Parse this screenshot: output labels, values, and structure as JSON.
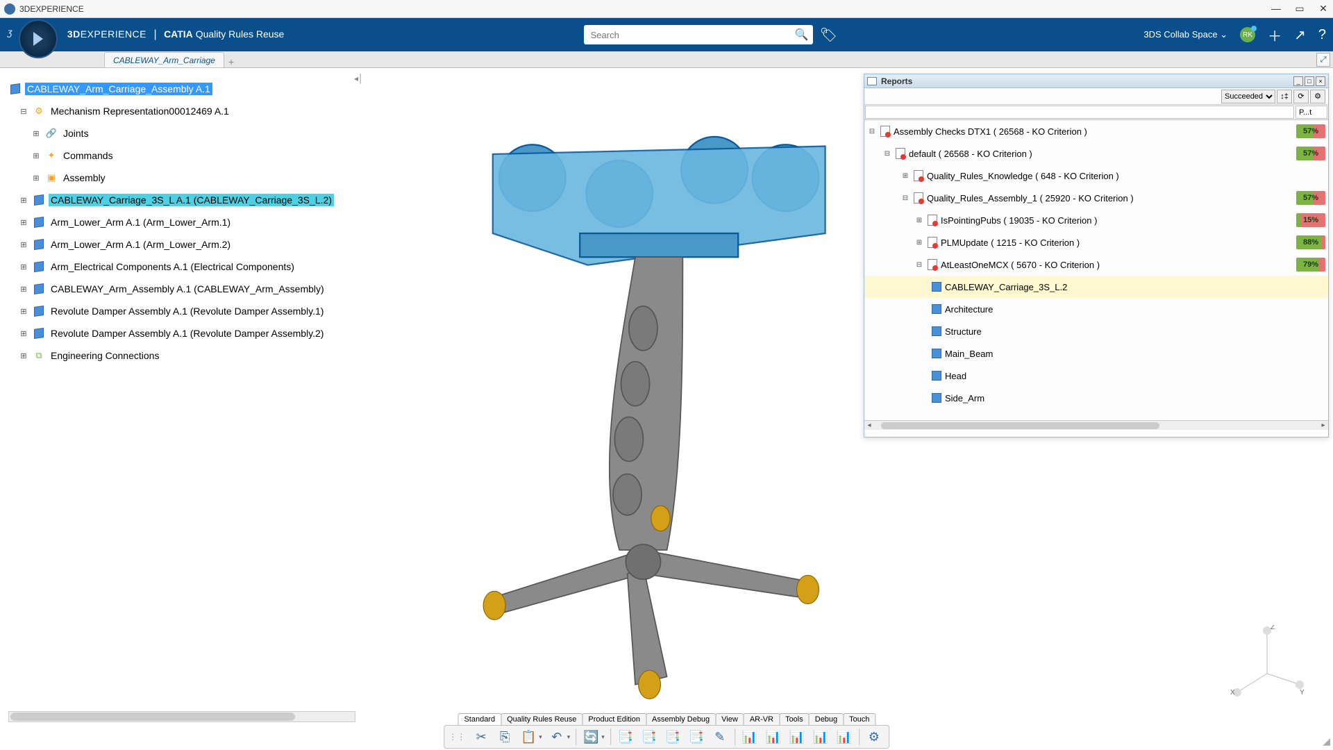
{
  "window": {
    "title": "3DEXPERIENCE"
  },
  "header": {
    "brand_prefix": "3D",
    "brand_suffix": "EXPERIENCE",
    "separator": "|",
    "catia": "CATIA",
    "module": "Quality Rules Reuse",
    "search_placeholder": "Search",
    "collab": "3DS Collab Space",
    "avatar": "RK"
  },
  "tabbar": {
    "tab0": "CABLEWAY_Arm_Carriage"
  },
  "tree": {
    "root": "CABLEWAY_Arm_Carriage_Assembly A.1",
    "n1": "Mechanism Representation00012469 A.1",
    "n1a": "Joints",
    "n1b": "Commands",
    "n1c": "Assembly",
    "n2": "CABLEWAY_Carriage_3S_L A.1 (CABLEWAY_Carriage_3S_L.2)",
    "n3": "Arm_Lower_Arm A.1 (Arm_Lower_Arm.1)",
    "n4": "Arm_Lower_Arm A.1 (Arm_Lower_Arm.2)",
    "n5": "Arm_Electrical Components A.1 (Electrical Components)",
    "n6": "CABLEWAY_Arm_Assembly A.1 (CABLEWAY_Arm_Assembly)",
    "n7": "Revolute Damper Assembly A.1 (Revolute Damper Assembly.1)",
    "n8": "Revolute Damper Assembly A.1 (Revolute Damper Assembly.2)",
    "n9": "Engineering Connections"
  },
  "reports": {
    "title": "Reports",
    "filter": "Succeeded",
    "col2": "P...t",
    "r0": "Assembly Checks DTX1   ( 26568 - KO Criterion )",
    "r0b": "57%",
    "r1": "default ( 26568 - KO Criterion )",
    "r1b": "57%",
    "r2": "Quality_Rules_Knowledge ( 648 - KO Criterion )",
    "r3": "Quality_Rules_Assembly_1 ( 25920 - KO Criterion )",
    "r3b": "57%",
    "r4": "IsPointingPubs ( 19035 - KO Criterion )",
    "r4b": "15%",
    "r5": "PLMUpdate ( 1215 - KO Criterion )",
    "r5b": "88%",
    "r6": "AtLeastOneMCX ( 5670 - KO Criterion )",
    "r6b": "79%",
    "r7": "CABLEWAY_Carriage_3S_L.2",
    "r8": "Architecture",
    "r9": "Structure",
    "r10": "Main_Beam",
    "r11": "Head",
    "r12": "Side_Arm"
  },
  "axis": {
    "x": "X",
    "y": "Y",
    "z": "Z"
  },
  "bottom_tabs": {
    "t0": "Standard",
    "t1": "Quality Rules Reuse",
    "t2": "Product Edition",
    "t3": "Assembly Debug",
    "t4": "View",
    "t5": "AR-VR",
    "t6": "Tools",
    "t7": "Debug",
    "t8": "Touch"
  }
}
